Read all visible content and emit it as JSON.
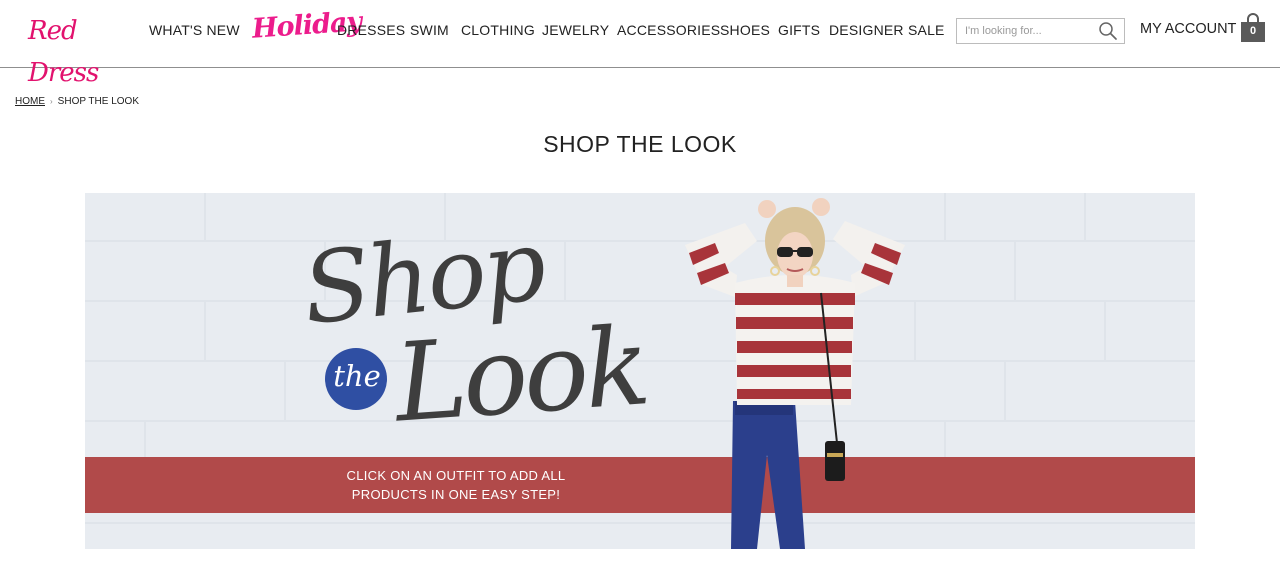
{
  "header": {
    "logo_text": "Red Dress",
    "nav": {
      "whats_new": "WHAT'S NEW",
      "holiday": "Holiday",
      "dresses": "DRESSES",
      "swim": "SWIM",
      "clothing": "CLOTHING",
      "jewelry": "JEWELRY",
      "accessories": "ACCESSORIES",
      "shoes": "SHOES",
      "gifts": "GIFTS",
      "designer": "DESIGNER",
      "sale": "SALE"
    },
    "search": {
      "placeholder": "I'm looking for..."
    },
    "account_label": "MY ACCOUNT",
    "bag_count": "0"
  },
  "breadcrumb": {
    "home": "HOME",
    "current": "SHOP THE LOOK"
  },
  "page_title": "SHOP THE LOOK",
  "banner": {
    "script_shop": "Shop",
    "script_the": "the",
    "script_look": "Look",
    "promo_line1": "CLICK ON AN OUTFIT TO ADD ALL",
    "promo_line2": "PRODUCTS IN ONE EASY STEP!"
  },
  "colors": {
    "brand_pink": "#e2126e",
    "promo_red": "#b14a4a",
    "circle_blue": "#2f4fa3",
    "banner_wall": "#e9edf2"
  }
}
